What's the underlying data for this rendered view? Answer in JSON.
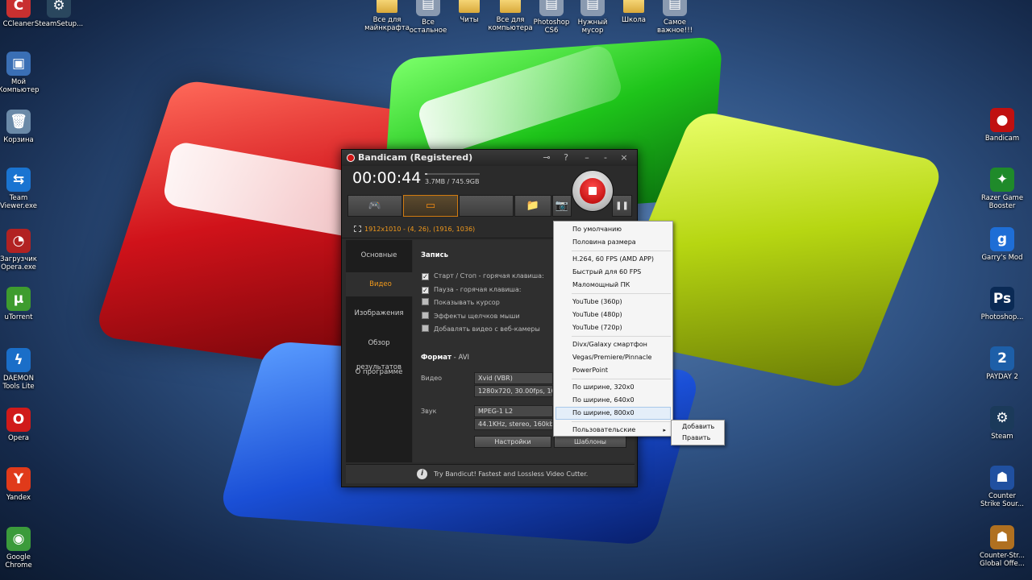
{
  "desktop": {
    "left_icons": [
      {
        "label": "CCleaner",
        "glyph": "C",
        "color": "#c83030",
        "icon": "ccleaner-icon"
      },
      {
        "label": "Мой\nКомпьютер",
        "glyph": "▣",
        "color": "#3a6fb5",
        "icon": "my-computer-icon"
      },
      {
        "label": "Корзина",
        "glyph": "🗑",
        "color": "#6b8aa8",
        "icon": "recycle-bin-icon"
      },
      {
        "label": "Team\nViewer.exe",
        "glyph": "⇆",
        "color": "#1a74d1",
        "icon": "teamviewer-icon"
      },
      {
        "label": "Загрузчик\nOpera.exe",
        "glyph": "◔",
        "color": "#b22222",
        "icon": "opera-installer-icon"
      },
      {
        "label": "uTorrent",
        "glyph": "µ",
        "color": "#3e9c2e",
        "icon": "utorrent-icon"
      },
      {
        "label": "DAEMON\nTools Lite",
        "glyph": "ϟ",
        "color": "#1a6ec8",
        "icon": "daemon-tools-icon"
      },
      {
        "label": "Opera",
        "glyph": "O",
        "color": "#d01a1a",
        "icon": "opera-icon"
      },
      {
        "label": "Yandex",
        "glyph": "Y",
        "color": "#e03a1a",
        "icon": "yandex-icon"
      },
      {
        "label": "Google\nChrome",
        "glyph": "◉",
        "color": "#3b9b3b",
        "icon": "chrome-icon"
      }
    ],
    "second_left_icon": {
      "label": "SteamSetup...",
      "glyph": "⚙",
      "color": "#2a475e",
      "icon": "steam-setup-icon"
    },
    "top_icons": [
      {
        "label": "Все для\nмайнкрафта",
        "folder": true
      },
      {
        "label": "Все\nостальное",
        "folder": false
      },
      {
        "label": "Читы",
        "folder": true
      },
      {
        "label": "Все для\nкомпьютера",
        "folder": true
      },
      {
        "label": "Photoshop\nCS6",
        "folder": false
      },
      {
        "label": "Нужный\nмусор",
        "folder": false
      },
      {
        "label": "Школа",
        "folder": true
      },
      {
        "label": "Самое\nважное!!!",
        "folder": false
      }
    ],
    "right_icons": [
      {
        "label": "Bandicam",
        "glyph": "●",
        "color": "#c01010",
        "icon": "bandicam-icon"
      },
      {
        "label": "Razer Game\nBooster",
        "glyph": "✦",
        "color": "#1f8a2a",
        "icon": "razer-icon"
      },
      {
        "label": "Garry's Mod",
        "glyph": "g",
        "color": "#1e6ed6",
        "icon": "garrys-mod-icon"
      },
      {
        "label": "Photoshop...",
        "glyph": "Ps",
        "color": "#0a2a55",
        "icon": "photoshop-icon"
      },
      {
        "label": "PAYDAY 2",
        "glyph": "2",
        "color": "#1d5fa8",
        "icon": "payday-icon"
      },
      {
        "label": "Steam",
        "glyph": "⚙",
        "color": "#1b3a5a",
        "icon": "steam-icon"
      },
      {
        "label": "Counter\nStrike Sour...",
        "glyph": "☗",
        "color": "#2050a0",
        "icon": "counter-strike-icon"
      },
      {
        "label": "Counter-Str...\nGlobal Offe...",
        "glyph": "☗",
        "color": "#b07020",
        "icon": "csgo-icon"
      }
    ]
  },
  "bandicam": {
    "title": "Bandicam (Registered)",
    "timer": "00:00:44",
    "file_size": "3.7MB / 745.9GB",
    "size_fraction": 0.05,
    "title_buttons": {
      "key": "⊸",
      "help": "?",
      "minimize": "–",
      "restore": "-",
      "close": "×"
    },
    "toolbar": {
      "game": "🎮",
      "screen": "▭",
      "device": "",
      "folder": "📁",
      "camera": "📷",
      "pause": "❚❚"
    },
    "region": "1912x1010 - (4, 26), (1916, 1036)",
    "sidebar": [
      {
        "label": "Основные",
        "active": false
      },
      {
        "label": "Видео",
        "active": true
      },
      {
        "label": "Изображения",
        "active": false
      },
      {
        "label": "Обзор результатов",
        "active": false
      },
      {
        "label": "О программе",
        "active": false
      }
    ],
    "record_section": "Запись",
    "checkboxes": [
      {
        "label": "Старт / Стоп - горячая клавиша:",
        "checked": true
      },
      {
        "label": "Пауза - горячая клавиша:",
        "checked": true
      },
      {
        "label": "Показывать курсор",
        "checked": false
      },
      {
        "label": "Эффекты щелчков мыши",
        "checked": false
      },
      {
        "label": "Добавлять видео с веб-камеры",
        "checked": false
      }
    ],
    "format_label": "Формат",
    "format_value": "AVI",
    "video_label": "Видео",
    "video_codec": "Xvid (VBR)",
    "video_details": "1280x720, 30.00fps, 100q",
    "audio_label": "Звук",
    "audio_codec": "MPEG-1 L2",
    "audio_details": "44.1KHz, stereo, 160kbps",
    "settings_button": "Настройки",
    "templates_button": "Шаблоны",
    "footer_icon": "i",
    "footer_text": "Try Bandicut! Fastest and Lossless Video Cutter."
  },
  "presets_menu": {
    "groups": [
      [
        "По умолчанию",
        "Половина размера"
      ],
      [
        "H.264, 60 FPS (AMD APP)",
        "Быстрый для 60 FPS",
        "Маломощный ПК"
      ],
      [
        "YouTube (360p)",
        "YouTube (480p)",
        "YouTube (720p)"
      ],
      [
        "Divx/Galaxy смартфон",
        "Vegas/Premiere/Pinnacle",
        "PowerPoint"
      ],
      [
        "По ширине, 320x0",
        "По ширине, 640x0",
        "По ширине, 800x0"
      ],
      [
        "Пользовательские"
      ]
    ],
    "highlighted": "По ширине, 800x0",
    "submenu_arrow": "▸"
  },
  "custom_submenu": {
    "items": [
      "Добавить",
      "Править"
    ]
  }
}
